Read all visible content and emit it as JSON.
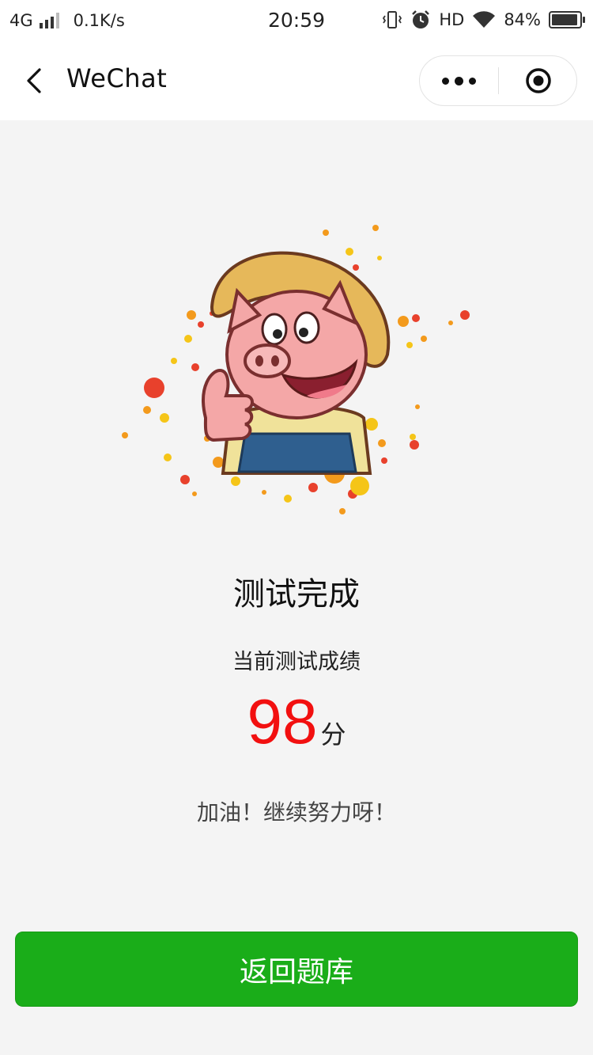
{
  "status_bar": {
    "network": "4G",
    "speed": "0.1K/s",
    "time": "20:59",
    "hd": "HD",
    "battery": "84%",
    "battery_level": 0.84
  },
  "nav": {
    "title": "WeChat"
  },
  "result": {
    "title": "测试完成",
    "score_label": "当前测试成绩",
    "score": "98",
    "unit": "分",
    "message": "加油！继续努力呀！"
  },
  "actions": {
    "back_to_bank": "返回题库"
  },
  "colors": {
    "accent": "#1aad19",
    "score": "#f21010"
  },
  "icons": [
    "back-chevron-icon",
    "more-dots-icon",
    "close-target-icon",
    "pig-farmer-illustration"
  ]
}
